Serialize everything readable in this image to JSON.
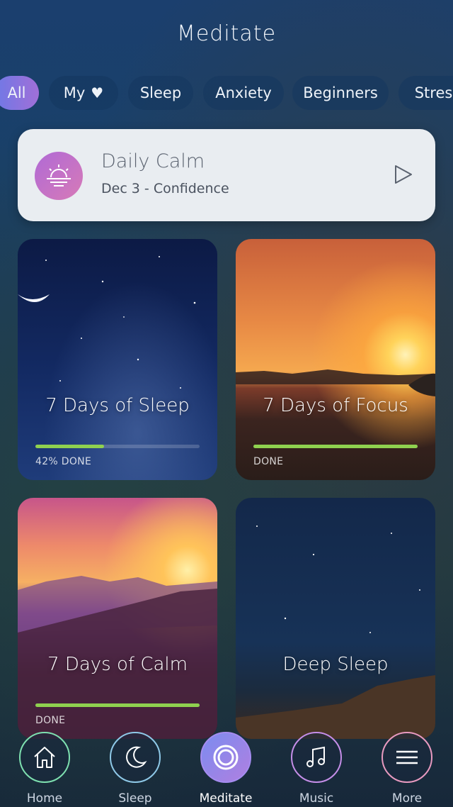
{
  "header": {
    "title": "Meditate"
  },
  "tabs": [
    {
      "label": "All",
      "active": true
    },
    {
      "label": "My",
      "icon": "heart-icon"
    },
    {
      "label": "Sleep"
    },
    {
      "label": "Anxiety"
    },
    {
      "label": "Beginners"
    },
    {
      "label": "Stress"
    }
  ],
  "daily_calm": {
    "title": "Daily Calm",
    "subtitle": "Dec 3 - Confidence",
    "icon": "sunrise-icon",
    "action_icon": "play-icon"
  },
  "cards": [
    {
      "title": "7 Days of Sleep",
      "progress": 0.42,
      "status": "42% DONE"
    },
    {
      "title": "7 Days of Focus",
      "progress": 1.0,
      "status": "DONE"
    },
    {
      "title": "7 Days of Calm",
      "progress": 1.0,
      "status": "DONE"
    },
    {
      "title": "Deep Sleep"
    }
  ],
  "nav": [
    {
      "label": "Home",
      "icon": "home-icon"
    },
    {
      "label": "Sleep",
      "icon": "moon-icon"
    },
    {
      "label": "Meditate",
      "icon": "meditate-icon",
      "active": true
    },
    {
      "label": "Music",
      "icon": "music-note-icon"
    },
    {
      "label": "More",
      "icon": "menu-icon"
    }
  ],
  "colors": {
    "accent": "#8fd14f",
    "tab_active_start": "#6f79e6",
    "tab_active_end": "#a06fd8"
  }
}
